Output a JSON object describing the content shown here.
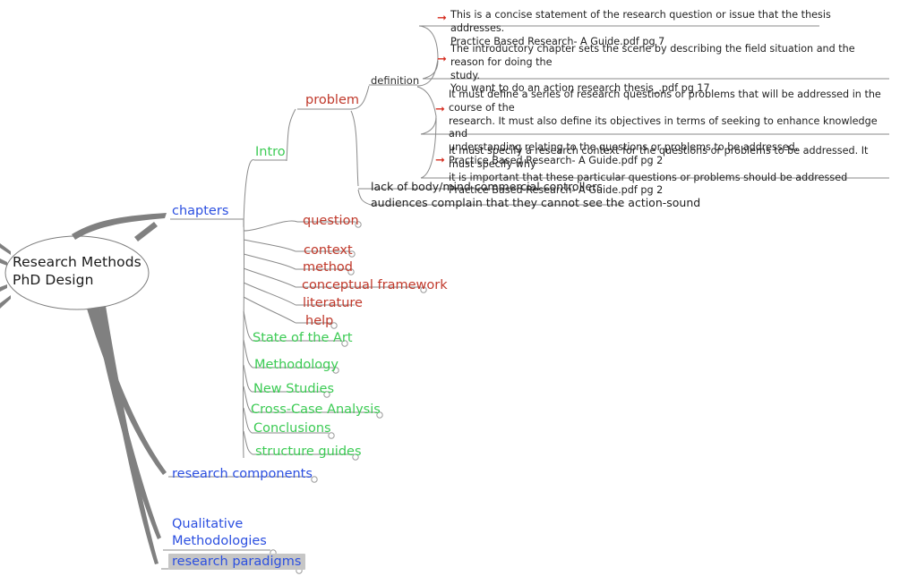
{
  "app": {
    "kind": "mind-map",
    "background": "#ffffff"
  },
  "colors": {
    "root_text": "#1a1a1a",
    "blue": "#2b4fe0",
    "green": "#3ccb54",
    "red": "#c0392b",
    "dark": "#2e2e2e",
    "black": "#1c1c1c",
    "branch": "#808080",
    "line": "#8a8a8a",
    "arrow": "#d52b1e",
    "selection": "#c6c6c6"
  },
  "root": {
    "label": "Research Methods\nPhD Design"
  },
  "branches": {
    "chapters": {
      "label": "chapters",
      "color": "blue"
    },
    "research_components": {
      "label": "research components",
      "color": "blue"
    },
    "qualitative_methodologies": {
      "label": "Qualitative\nMethodologies",
      "color": "blue"
    },
    "research_paradigms": {
      "label": "research paradigms",
      "color": "blue",
      "selected": true
    }
  },
  "chapters_children": [
    {
      "label": "Intro",
      "color": "green"
    },
    {
      "label": "question",
      "color": "red"
    },
    {
      "label": "context",
      "color": "red"
    },
    {
      "label": "method",
      "color": "red"
    },
    {
      "label": "conceptual framework",
      "color": "red"
    },
    {
      "label": "literature",
      "color": "red"
    },
    {
      "label": "help",
      "color": "red"
    },
    {
      "label": "State of the Art",
      "color": "green"
    },
    {
      "label": "Methodology",
      "color": "green"
    },
    {
      "label": "New Studies",
      "color": "green"
    },
    {
      "label": "Cross-Case Analysis",
      "color": "green"
    },
    {
      "label": "Conclusions",
      "color": "green"
    },
    {
      "label": "structure guides",
      "color": "green"
    }
  ],
  "intro_children": [
    {
      "label": "problem",
      "color": "red"
    }
  ],
  "problem_children": [
    {
      "label": "definition",
      "color": "dark"
    },
    {
      "label": "lack of body/mind commercial controllers",
      "color": "black"
    },
    {
      "label": "audiences complain that they cannot see the action-sound",
      "color": "black"
    }
  ],
  "definition_notes": [
    {
      "text": "This is a concise statement of the research question or issue that the thesis addresses.\nPractice Based Research- A Guide.pdf pg 7",
      "bullet": "arrow-right-icon"
    },
    {
      "text": "The introductory chapter sets the scene by describing the field situation and the reason for doing the\nstudy.\nYou want to do an action research thesis_.pdf pg 17",
      "bullet": "arrow-right-icon"
    },
    {
      "text": "It must define a series of research questions or problems that will be addressed in the course of the\nresearch. It must also define its objectives in terms of seeking to enhance knowledge and\nunderstanding relating to the questions or problems to be addressed.\nPractice Based Research- A Guide.pdf pg 2",
      "bullet": "arrow-right-icon"
    },
    {
      "text": "It must specify a research context for the questions or problems to be addressed. It must specify why\nit is important that these particular questions or problems should be addressed\nPractice Based Research- A Guide.pdf pg 2",
      "bullet": "arrow-right-icon"
    }
  ]
}
